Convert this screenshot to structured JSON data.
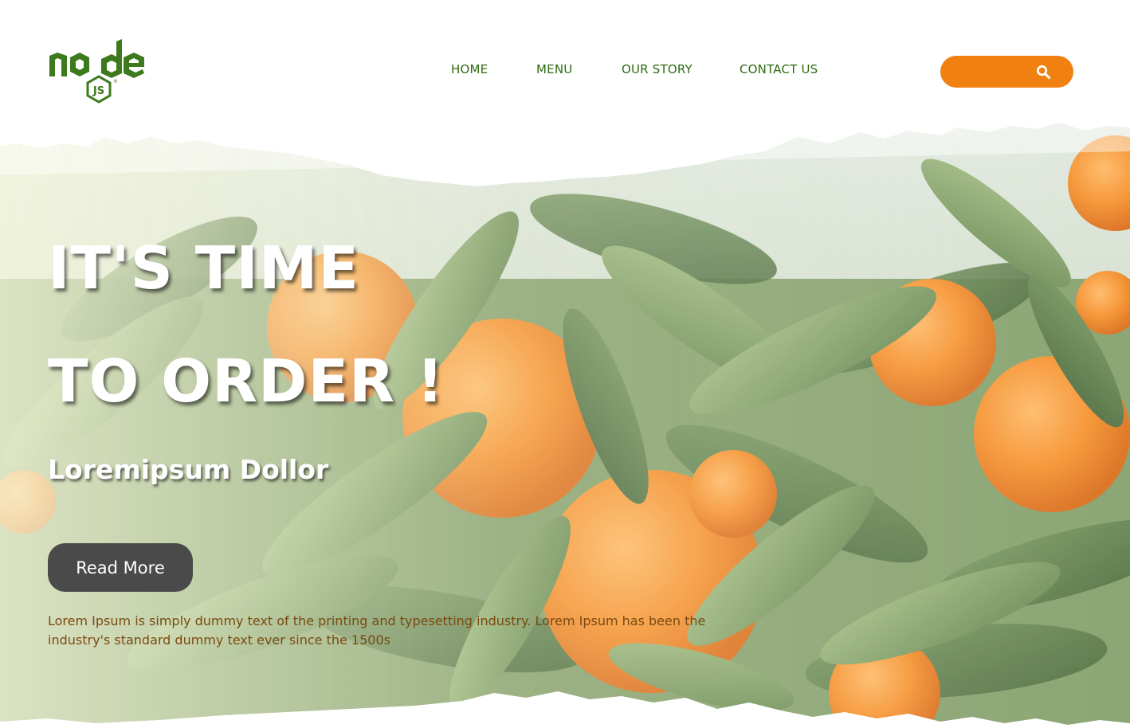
{
  "header": {
    "logo_alt": "node js",
    "nav": {
      "home": "HOME",
      "menu": "MENU",
      "our_story": "OUR STORY",
      "contact_us": "CONTACT US"
    },
    "search_icon": "search-icon"
  },
  "hero": {
    "headline_line1": "IT'S TIME",
    "headline_line2": "TO ORDER !",
    "subtitle": "Loremipsum Dollor",
    "read_more_label": "Read More",
    "description": "Lorem Ipsum is simply dummy text of the printing and typesetting industry. Lorem Ipsum has been the industry's standard dummy text ever since the 1500s",
    "background": "orange-tree-photo"
  },
  "colors": {
    "brand_green": "#2e6b12",
    "accent_orange": "#f08010",
    "button_dark": "#4a4a4a",
    "description_text": "#7a4a10"
  }
}
